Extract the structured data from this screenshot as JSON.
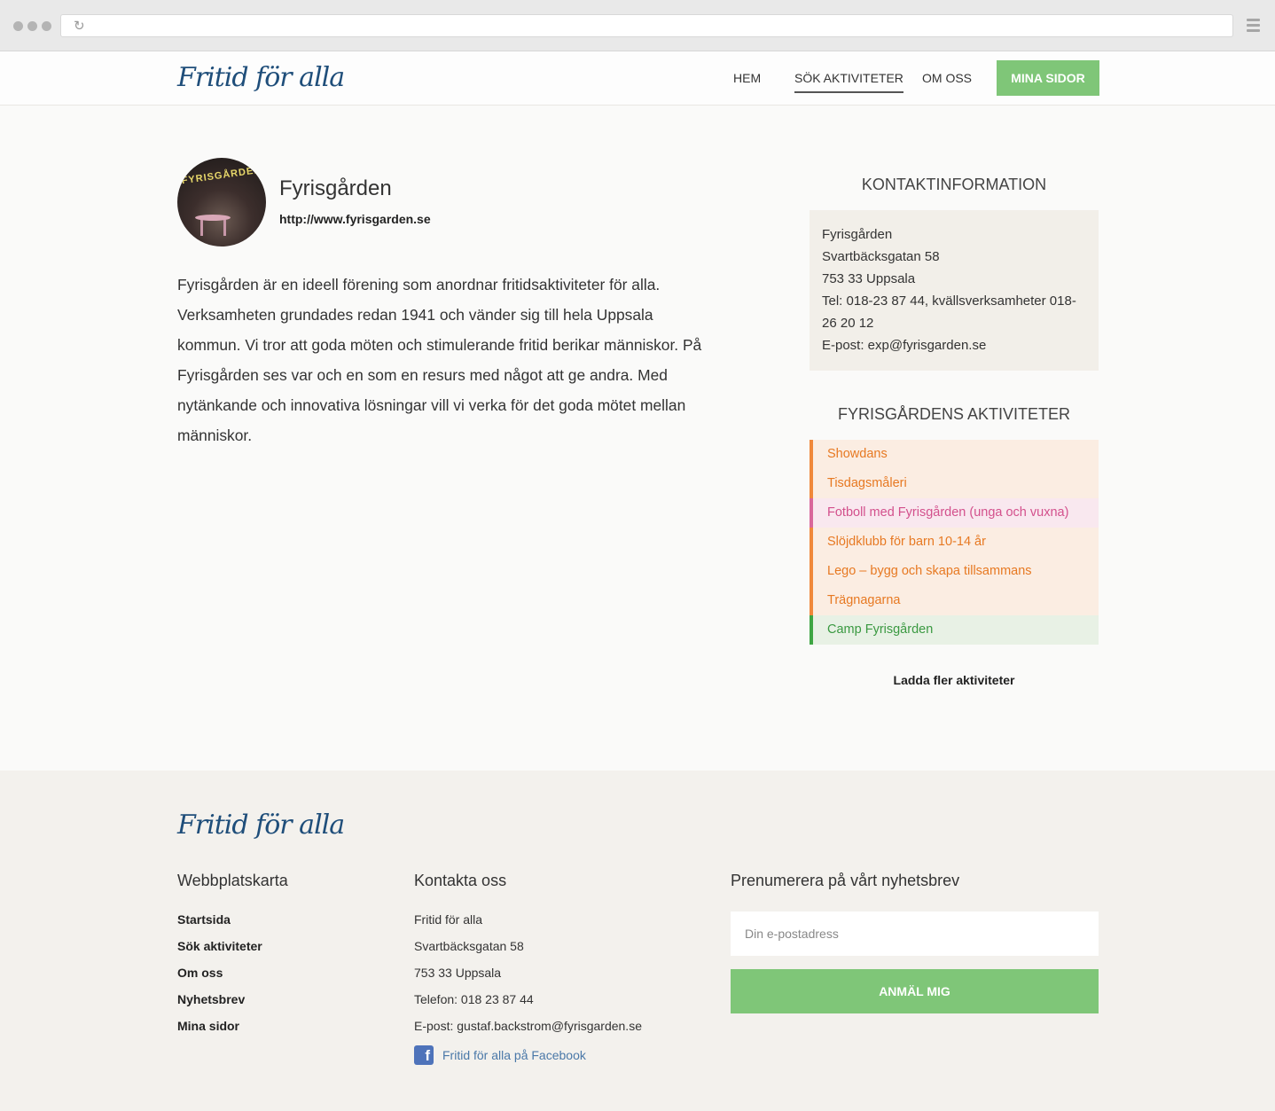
{
  "header": {
    "logo": "Fritid för alla",
    "nav": [
      "HEM",
      "SÖK AKTIVITETER",
      "OM OSS"
    ],
    "cta": "MINA SIDOR"
  },
  "organization": {
    "name": "Fyrisgården",
    "url": "http://www.fyrisgarden.se",
    "avatar_text": "FYRISGÅRDEN",
    "description": "Fyrisgården är en ideell förening som anordnar fritidsaktiviteter för alla. Verksamheten grundades redan 1941 och vänder sig till hela Uppsala kommun. Vi tror att goda möten och stimulerande fritid berikar människor. På Fyrisgården ses var och en som en resurs med något att ge andra. Med nytänkande och innovativa lösningar vill vi verka för det goda mötet mellan människor."
  },
  "sidebar": {
    "contact_heading": "KONTAKTINFORMATION",
    "contact_lines": [
      "Fyrisgården",
      "Svartbäcksgatan 58",
      "753 33 Uppsala",
      "Tel: 018-23 87 44, kvällsverksamheter 018-26 20 12",
      "E-post: exp@fyrisgarden.se"
    ],
    "activities_heading": "FYRISGÅRDENS AKTIVITETER",
    "activities": [
      {
        "label": "Showdans",
        "color": "orange"
      },
      {
        "label": "Tisdagsmåleri",
        "color": "orange"
      },
      {
        "label": "Fotboll med Fyrisgården (unga och vuxna)",
        "color": "pink"
      },
      {
        "label": "Slöjdklubb för barn 10-14 år",
        "color": "orange"
      },
      {
        "label": "Lego – bygg och skapa tillsammans",
        "color": "orange"
      },
      {
        "label": "Trägnagarna",
        "color": "orange"
      },
      {
        "label": "Camp Fyrisgården",
        "color": "green"
      }
    ],
    "load_more": "Ladda fler aktiviteter"
  },
  "footer": {
    "logo": "Fritid för alla",
    "sitemap_heading": "Webbplatskarta",
    "sitemap": [
      "Startsida",
      "Sök aktiviteter",
      "Om oss",
      "Nyhetsbrev",
      "Mina sidor"
    ],
    "contact_heading": "Kontakta oss",
    "contact": [
      "Fritid för alla",
      "Svartbäcksgatan 58",
      "753 33 Uppsala",
      "Telefon: 018 23 87 44",
      "E-post: gustaf.backstrom@fyrisgarden.se"
    ],
    "facebook": "Fritid för alla på Facebook",
    "newsletter_heading": "Prenumerera på vårt nyhetsbrev",
    "newsletter_placeholder": "Din e-postadress",
    "newsletter_button": "ANMÄL MIG"
  },
  "colors": {
    "accent_green": "#7fc678",
    "activity_orange": "#f0883a",
    "activity_pink": "#d9679b",
    "activity_green": "#3ea543",
    "logo_blue": "#1f4e7a"
  }
}
